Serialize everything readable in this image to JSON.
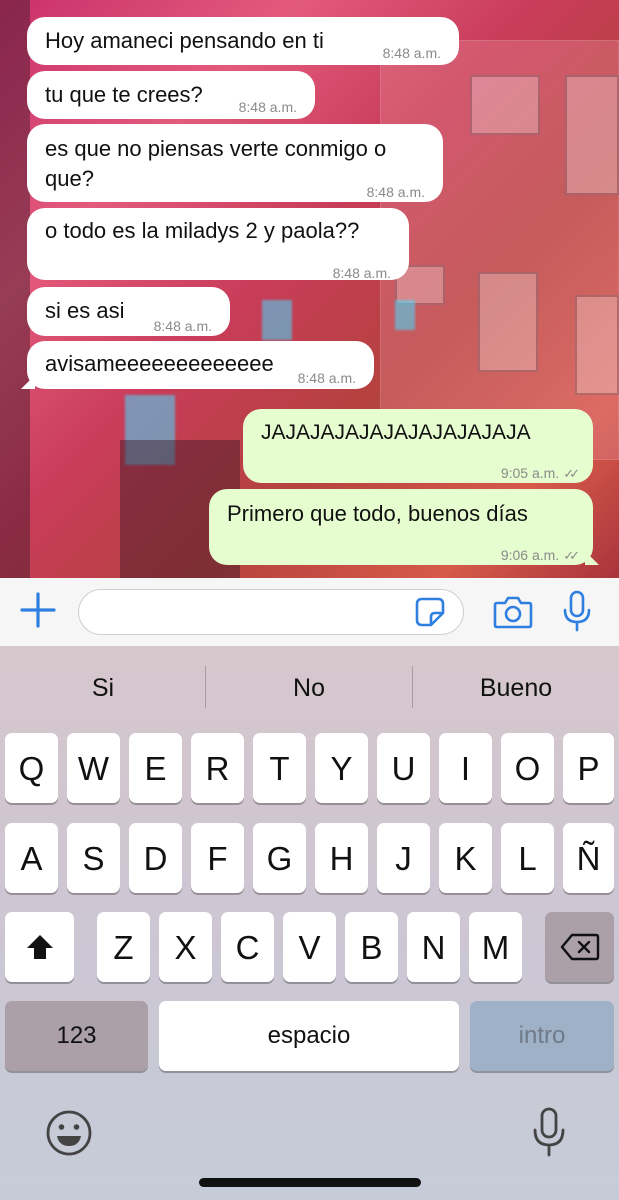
{
  "chat": {
    "messages": [
      {
        "text": "Hoy amaneci pensando en ti",
        "time": "8:48 a.m."
      },
      {
        "text": "tu que te crees?",
        "time": "8:48 a.m."
      },
      {
        "text": "es que no piensas verte conmigo o que?",
        "time": "8:48 a.m."
      },
      {
        "text": "o todo es la miladys 2 y paola??",
        "time": "8:48 a.m."
      },
      {
        "text": "si es asi",
        "time": "8:48 a.m."
      },
      {
        "text": "avisameeeeeeeeeeeee",
        "time": "8:48 a.m."
      },
      {
        "text": "JAJAJAJAJAJAJAJAJAJAJA",
        "time": "9:05 a.m.",
        "status": "✓✓"
      },
      {
        "text": "Primero que todo, buenos días",
        "time": "9:06 a.m.",
        "status": "✓✓"
      }
    ]
  },
  "input_bar": {
    "placeholder": "",
    "icons": [
      "plus-icon",
      "sticker-icon",
      "camera-icon",
      "microphone-icon"
    ],
    "accent": "#2f7fe0"
  },
  "keyboard": {
    "suggestions": [
      "Si",
      "No",
      "Bueno"
    ],
    "row1": [
      "Q",
      "W",
      "E",
      "R",
      "T",
      "Y",
      "U",
      "I",
      "O",
      "P"
    ],
    "row2": [
      "A",
      "S",
      "D",
      "F",
      "G",
      "H",
      "J",
      "K",
      "L",
      "Ñ"
    ],
    "row3": [
      "Z",
      "X",
      "C",
      "V",
      "B",
      "N",
      "M"
    ],
    "numbers_label": "123",
    "space_label": "espacio",
    "return_label": "intro",
    "icons": [
      "shift-icon",
      "backspace-icon",
      "emoji-icon",
      "dictation-mic-icon"
    ]
  },
  "colors": {
    "incoming_bubble": "#ffffff",
    "outgoing_bubble": "#e6fdcf",
    "timestamp": "#8a8a8a"
  }
}
